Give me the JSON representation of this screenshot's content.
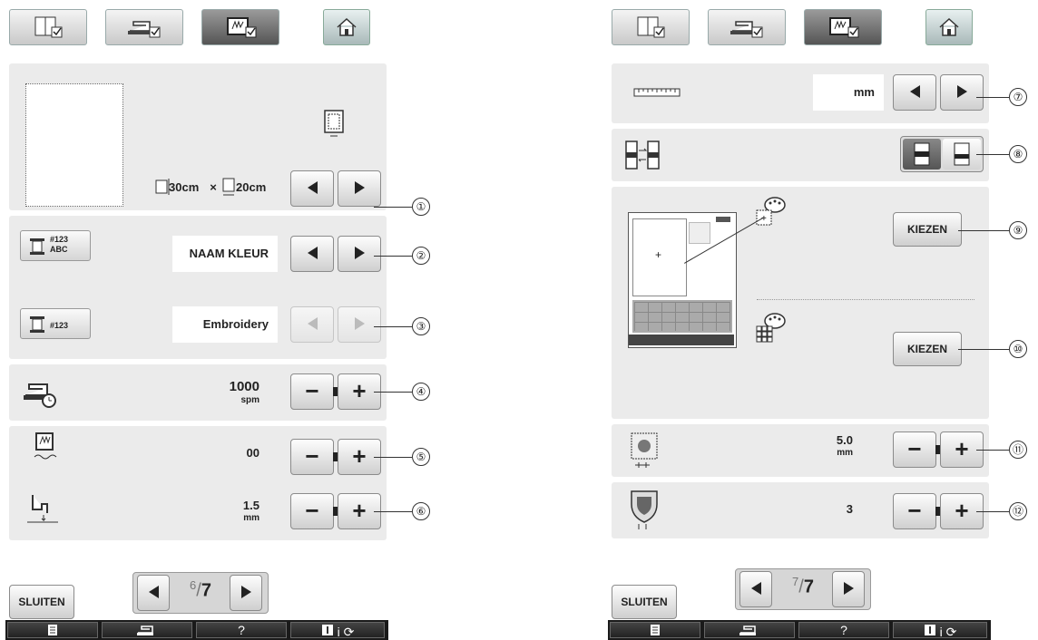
{
  "colors": {
    "panel": "#ebebeb",
    "button_grad_top": "#fdfdfd",
    "button_grad_bottom": "#cfcfcf",
    "bottom_bar": "#1a1a1a"
  },
  "left": {
    "tabs": [
      {
        "icon": "manual-book-icon"
      },
      {
        "icon": "sewing-machine-settings-icon"
      },
      {
        "icon": "embroidery-frame-settings-icon",
        "active": true
      }
    ],
    "home": {
      "icon": "home-icon"
    },
    "frame": {
      "width": "30cm",
      "times": "×",
      "height": "20cm",
      "callout": "①"
    },
    "thread_display": {
      "value": "NAAM KLEUR",
      "callout": "②"
    },
    "thread_brand": {
      "value": "Embroidery",
      "callout": "③"
    },
    "speed": {
      "value": "1000",
      "unit": "spm",
      "callout": "④"
    },
    "tension": {
      "value": "00",
      "callout": "⑤"
    },
    "foot_height": {
      "value": "1.5",
      "unit": "mm",
      "callout": "⑥"
    },
    "page": {
      "current": "6",
      "total": "7",
      "sep": "/"
    },
    "close_label": "SLUITEN",
    "bottom": [
      {
        "icon": "document-icon"
      },
      {
        "icon": "machine-icon"
      },
      {
        "label": "?"
      },
      {
        "icon": "needle-info-icon",
        "label": "i"
      }
    ]
  },
  "right": {
    "tabs": [
      {
        "icon": "manual-book-icon"
      },
      {
        "icon": "sewing-machine-settings-icon"
      },
      {
        "icon": "embroidery-frame-settings-icon",
        "active": true
      }
    ],
    "home": {
      "icon": "home-icon"
    },
    "units": {
      "value": "mm",
      "callout": "⑦"
    },
    "layout": {
      "callout": "⑧"
    },
    "bg_color": {
      "label": "KIEZEN",
      "callout": "⑨"
    },
    "thumb_color": {
      "label": "KIEZEN",
      "callout": "⑩"
    },
    "appliqué_distance": {
      "value": "5.0",
      "unit": "mm",
      "callout": "⑪"
    },
    "border_width": {
      "value": "3",
      "callout": "⑫"
    },
    "page": {
      "current": "7",
      "total": "7",
      "sep": "/"
    },
    "close_label": "SLUITEN",
    "bottom": [
      {
        "icon": "document-icon"
      },
      {
        "icon": "machine-icon"
      },
      {
        "label": "?"
      },
      {
        "icon": "needle-info-icon",
        "label": "i"
      }
    ]
  }
}
